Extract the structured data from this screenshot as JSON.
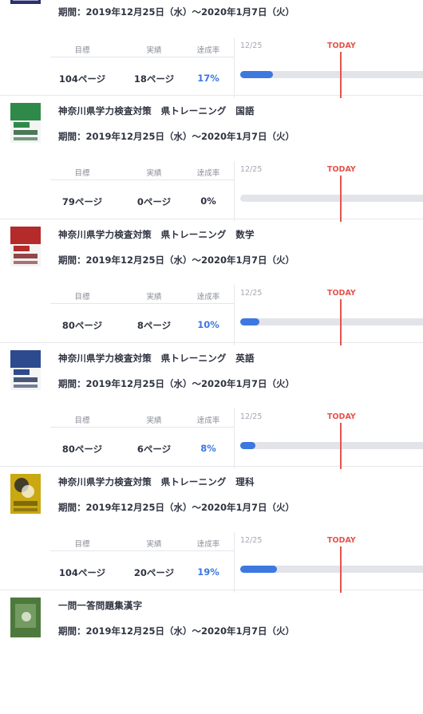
{
  "books": [
    {
      "title": "",
      "period": "期間：2019年12月25日（水）〜2020年1月7日（火）",
      "cover_label": "SOCIAL STUDIES",
      "cover_color": "#2b2f6e",
      "target": "104ページ",
      "actual": "18ページ",
      "rate": "17%",
      "progress": 0.17
    },
    {
      "title": "神奈川県学力検査対策　県トレーニング　国語",
      "period": "期間：2019年12月25日（水）〜2020年1月7日（火）",
      "cover_label": "JAPANESE",
      "cover_color": "#2f8a4a",
      "target": "79ページ",
      "actual": "0ページ",
      "rate": "0%",
      "progress": 0
    },
    {
      "title": "神奈川県学力検査対策　県トレーニング　数学",
      "period": "期間：2019年12月25日（水）〜2020年1月7日（火）",
      "cover_label": "MATHEMATICS",
      "cover_color": "#b52a2a",
      "target": "80ページ",
      "actual": "8ページ",
      "rate": "10%",
      "progress": 0.1
    },
    {
      "title": "神奈川県学力検査対策　県トレーニング　英語",
      "period": "期間：2019年12月25日（水）〜2020年1月7日（火）",
      "cover_label": "ENGLISH",
      "cover_color": "#2d4a8e",
      "target": "80ページ",
      "actual": "6ページ",
      "rate": "8%",
      "progress": 0.08
    },
    {
      "title": "神奈川県学力検査対策　県トレーニング　理科",
      "period": "期間：2019年12月25日（水）〜2020年1月7日（火）",
      "cover_label": "SCIENCE",
      "cover_color": "#c9a812",
      "target": "104ページ",
      "actual": "20ページ",
      "rate": "19%",
      "progress": 0.19
    },
    {
      "title": "一問一答問題集漢字",
      "period": "期間：2019年12月25日（水）〜2020年1月7日（火）",
      "cover_label": "",
      "cover_color": "#4d7a3c"
    }
  ],
  "labels": {
    "target": "目標",
    "actual": "実績",
    "rate": "達成率",
    "start_date": "12/25",
    "today": "TODAY"
  },
  "colors": {
    "accent": "#3d78e0",
    "today": "#e5534b",
    "track": "#e2e4e9"
  }
}
